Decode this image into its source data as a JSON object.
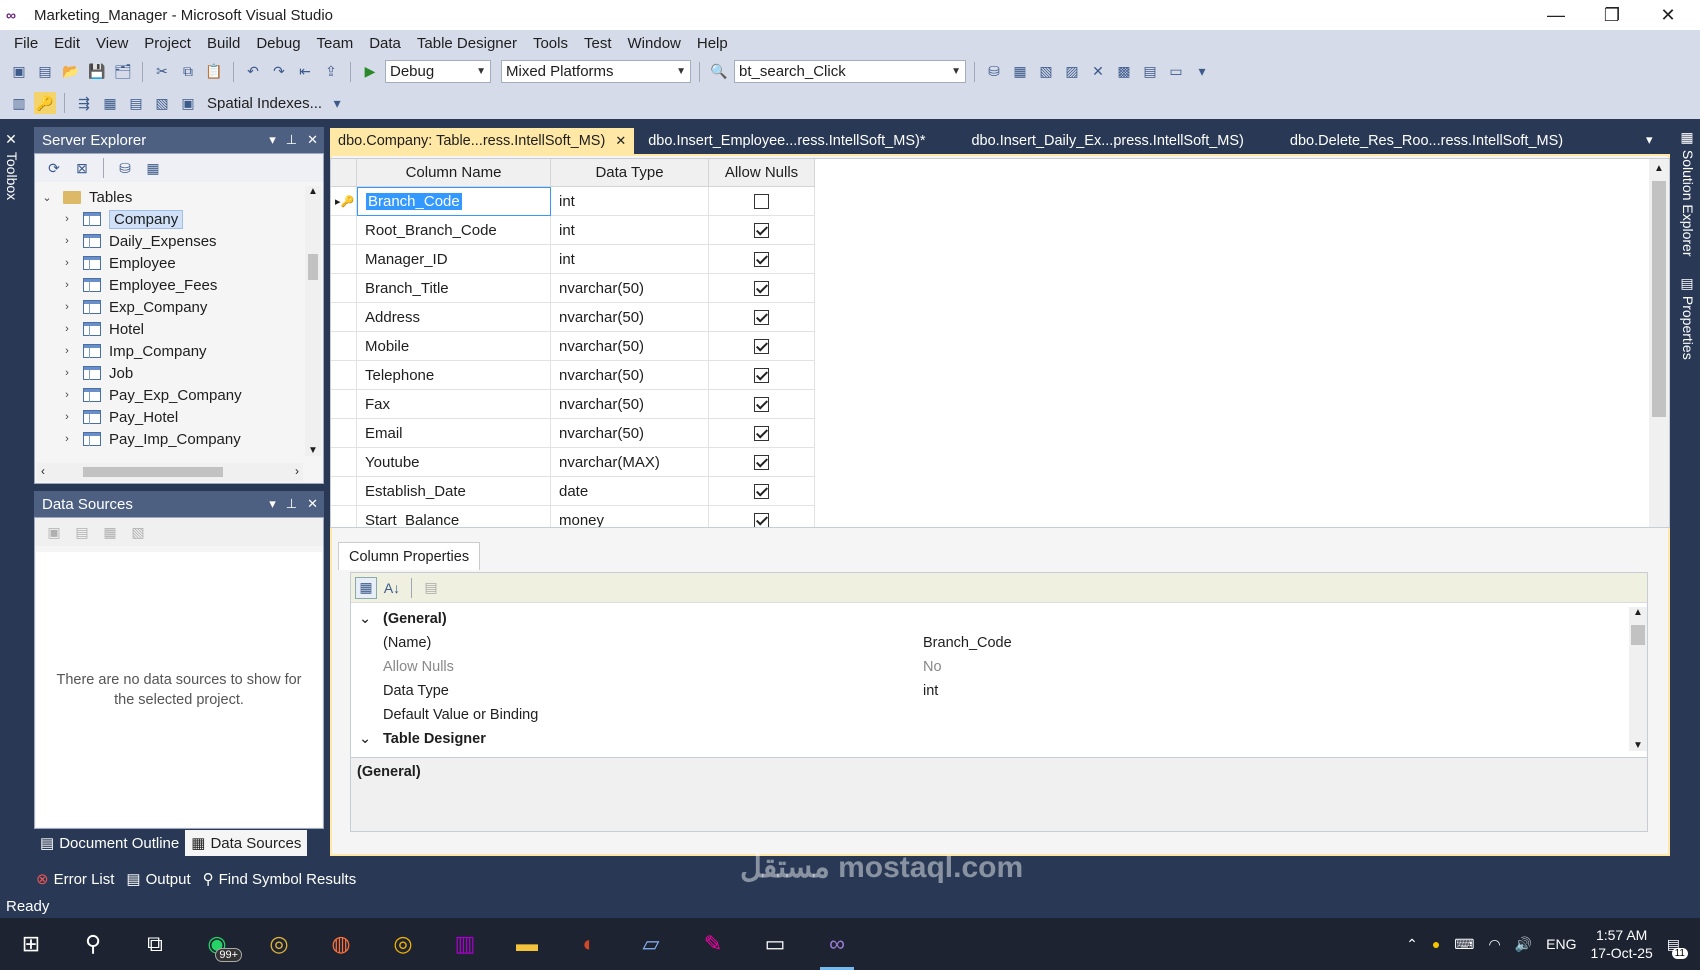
{
  "window": {
    "title": "Marketing_Manager - Microsoft Visual Studio",
    "controls": {
      "minimize": "—",
      "restore": "❐",
      "close": "✕"
    }
  },
  "menu": [
    "File",
    "Edit",
    "View",
    "Project",
    "Build",
    "Debug",
    "Team",
    "Data",
    "Table Designer",
    "Tools",
    "Test",
    "Window",
    "Help"
  ],
  "toolbar1": {
    "config": "Debug",
    "platform": "Mixed Platforms",
    "find": "bt_search_Click"
  },
  "toolbar2": {
    "spatial": "Spatial Indexes..."
  },
  "left_strip": {
    "toolbox": "Toolbox"
  },
  "right_strip": {
    "solution_explorer": "Solution Explorer",
    "properties": "Properties"
  },
  "server_explorer": {
    "title": "Server Explorer",
    "folder": "Tables",
    "items": [
      "Company",
      "Daily_Expenses",
      "Employee",
      "Employee_Fees",
      "Exp_Company",
      "Hotel",
      "Imp_Company",
      "Job",
      "Pay_Exp_Company",
      "Pay_Hotel",
      "Pay_Imp_Company"
    ]
  },
  "data_sources": {
    "title": "Data Sources",
    "empty_message": "There are no data sources to show for the selected project."
  },
  "panel_tabs": {
    "document_outline": "Document Outline",
    "data_sources": "Data Sources"
  },
  "doc_tabs": [
    "dbo.Company: Table...ress.IntellSoft_MS)",
    "dbo.Insert_Employee...ress.IntellSoft_MS)*",
    "dbo.Insert_Daily_Ex...press.IntellSoft_MS)",
    "dbo.Delete_Res_Roo...ress.IntellSoft_MS)"
  ],
  "grid": {
    "headers": {
      "name": "Column Name",
      "type": "Data Type",
      "nulls": "Allow Nulls"
    },
    "rows": [
      {
        "name": "Branch_Code",
        "type": "int",
        "nulls": false
      },
      {
        "name": "Root_Branch_Code",
        "type": "int",
        "nulls": true
      },
      {
        "name": "Manager_ID",
        "type": "int",
        "nulls": true
      },
      {
        "name": "Branch_Title",
        "type": "nvarchar(50)",
        "nulls": true
      },
      {
        "name": "Address",
        "type": "nvarchar(50)",
        "nulls": true
      },
      {
        "name": "Mobile",
        "type": "nvarchar(50)",
        "nulls": true
      },
      {
        "name": "Telephone",
        "type": "nvarchar(50)",
        "nulls": true
      },
      {
        "name": "Fax",
        "type": "nvarchar(50)",
        "nulls": true
      },
      {
        "name": "Email",
        "type": "nvarchar(50)",
        "nulls": true
      },
      {
        "name": "Youtube",
        "type": "nvarchar(MAX)",
        "nulls": true
      },
      {
        "name": "Establish_Date",
        "type": "date",
        "nulls": true
      },
      {
        "name": "Start_Balance",
        "type": "money",
        "nulls": true
      }
    ]
  },
  "column_properties": {
    "tab": "Column Properties",
    "general_header": "(General)",
    "rows": [
      {
        "name": "(Name)",
        "value": "Branch_Code"
      },
      {
        "name": "Allow Nulls",
        "value": "No"
      },
      {
        "name": "Data Type",
        "value": "int"
      },
      {
        "name": "Default Value or Binding",
        "value": ""
      }
    ],
    "designer_header": "Table Designer",
    "description": "(General)"
  },
  "bottom_tabs": [
    "Error List",
    "Output",
    "Find Symbol Results"
  ],
  "status": "Ready",
  "taskbar": {
    "badge": "99+",
    "language": "ENG",
    "time": "1:57 AM",
    "date": "17-Oct-25",
    "notification_count": "11"
  },
  "watermark": "مستقل mostaql.com"
}
